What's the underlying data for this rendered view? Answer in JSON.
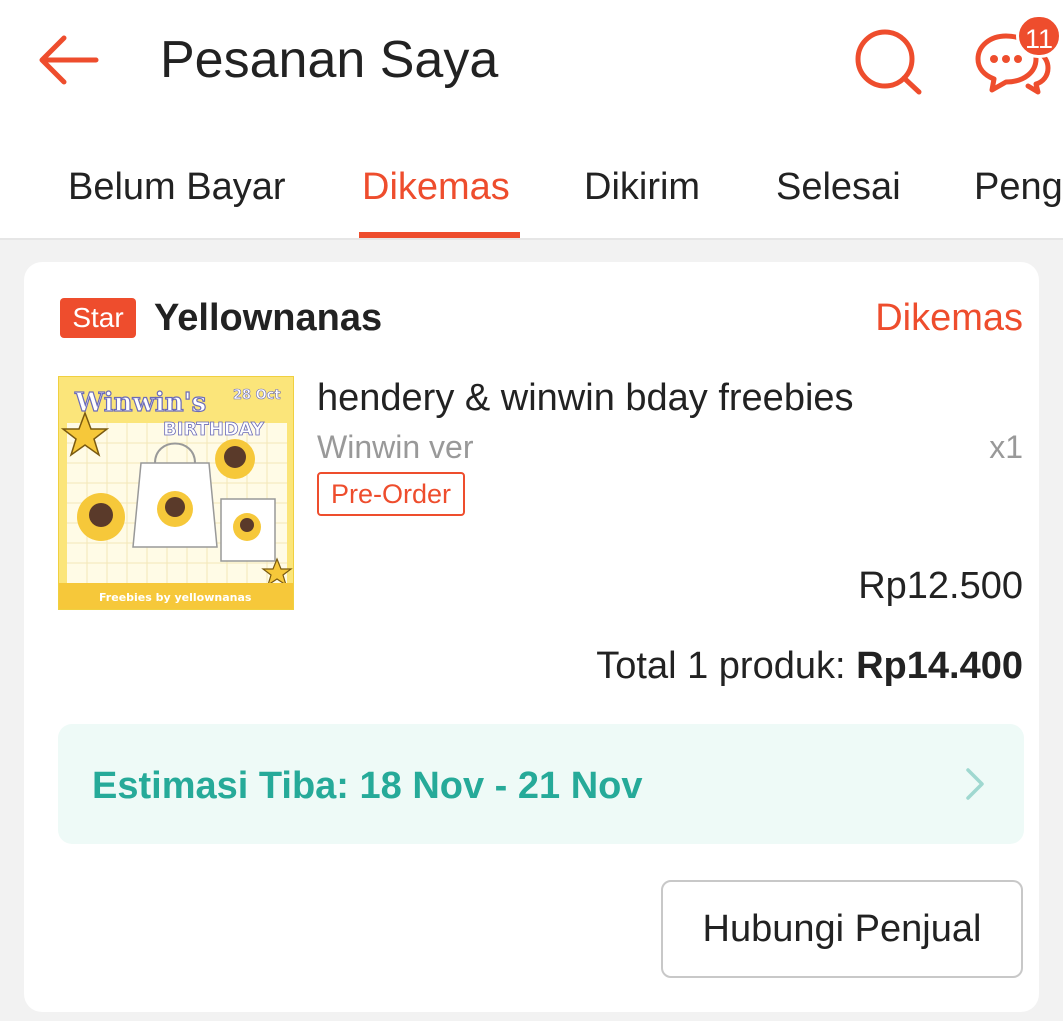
{
  "header": {
    "title": "Pesanan Saya",
    "chat_badge_count": "11",
    "accent_color": "#ee4d2d"
  },
  "tabs": [
    {
      "label": "Belum Bayar"
    },
    {
      "label": "Dikemas",
      "active": true
    },
    {
      "label": "Dikirim"
    },
    {
      "label": "Selesai"
    },
    {
      "label": "Peng"
    }
  ],
  "order": {
    "shop_badge": "Star",
    "shop_name": "Yellownanas",
    "status": "Dikemas",
    "product": {
      "name": "hendery & winwin bday freebies",
      "variant": "Winwin ver",
      "quantity": "x1",
      "tag": "Pre-Order",
      "price": "Rp12.500",
      "thumbnail_texts": {
        "title": "Winwin's",
        "subtitle": "BIRTHDAY",
        "date": "28 Oct",
        "footer": "Freebies by yellownanas"
      }
    },
    "total_label": "Total 1 produk: ",
    "total_value": "Rp14.400",
    "eta": "Estimasi Tiba: 18 Nov - 21 Nov",
    "eta_color": "#26aa99",
    "contact_button": "Hubungi Penjual"
  }
}
